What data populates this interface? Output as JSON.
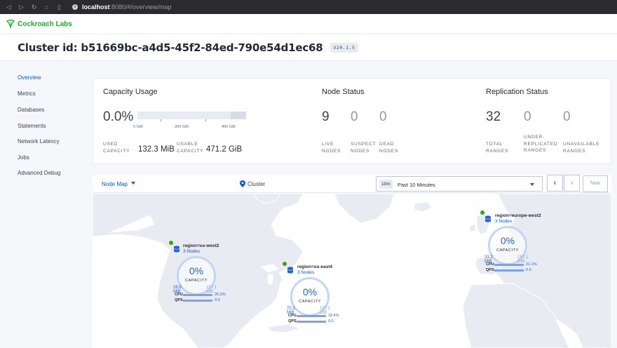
{
  "browser": {
    "host": "localhost",
    "path": ":8080/#/overview/map"
  },
  "header": {
    "brand": "Cockroach Labs"
  },
  "cluster": {
    "id_text": "Cluster id: b51669bc-a4d5-45f2-84ed-790e54d1ec68",
    "version": "V20.1.5"
  },
  "sidebar": {
    "items": [
      {
        "label": "Overview",
        "active": true
      },
      {
        "label": "Metrics",
        "active": false
      },
      {
        "label": "Databases",
        "active": false
      },
      {
        "label": "Statements",
        "active": false
      },
      {
        "label": "Network Latency",
        "active": false
      },
      {
        "label": "Jobs",
        "active": false
      },
      {
        "label": "Advanced Debug",
        "active": false
      }
    ]
  },
  "capacity": {
    "title": "Capacity Usage",
    "percent": "0.0%",
    "usage_fraction": 0.0,
    "ticks": [
      "0 GiB",
      "200 GiB",
      "400 GiB"
    ],
    "used_label": "USED CAPACITY",
    "used_value": "132.3 MiB",
    "usable_label": "USABLE CAPACITY",
    "usable_value": "471.2 GiB"
  },
  "node_status": {
    "title": "Node Status",
    "live": "9",
    "suspect": "0",
    "dead": "0",
    "live_label": "LIVE NODES",
    "suspect_label": "SUSPECT NODES",
    "dead_label": "DEAD NODES"
  },
  "replication": {
    "title": "Replication Status",
    "total": "32",
    "under": "0",
    "unavailable": "0",
    "total_label": "TOTAL RANGES",
    "under_label": "UNDER-REPLICATED RANGES",
    "unavailable_label": "UNAVAILABLE RANGES"
  },
  "map_controls": {
    "view": "Node Map",
    "scope": "Cluster",
    "time_badge": "10m",
    "time_label": "Past 10 Minutes",
    "prev": "‹",
    "next": "›",
    "now": "Now"
  },
  "regions": [
    {
      "name": "region=us-west2",
      "nodes": "3 Nodes",
      "percent": "0%",
      "capacity_label": "CAPACITY",
      "used": "28.9 MiB",
      "usable": "157.1 GiB",
      "cpu_label": "CPU",
      "cpu": "20.3%",
      "qps_label": "QPS",
      "qps": "0.0"
    },
    {
      "name": "region=us-east4",
      "nodes": "3 Nodes",
      "percent": "0%",
      "capacity_label": "CAPACITY",
      "used": "70.1 MiB",
      "usable": "157.1 GiB",
      "cpu_label": "CPU",
      "cpu": "18.4%",
      "qps_label": "QPS",
      "qps": "0.0"
    },
    {
      "name": "region=europe-west2",
      "nodes": "3 Nodes",
      "percent": "0%",
      "capacity_label": "CAPACITY",
      "used": "33.2 MiB",
      "usable": "157.1 GiB",
      "cpu_label": "CPU",
      "cpu": "21.1%",
      "qps_label": "QPS",
      "qps": "0.0"
    }
  ],
  "colors": {
    "accent": "#0055ff",
    "brand_green": "#18b12b",
    "status_ok": "#37a806",
    "map_land": "#e8ebf1"
  }
}
